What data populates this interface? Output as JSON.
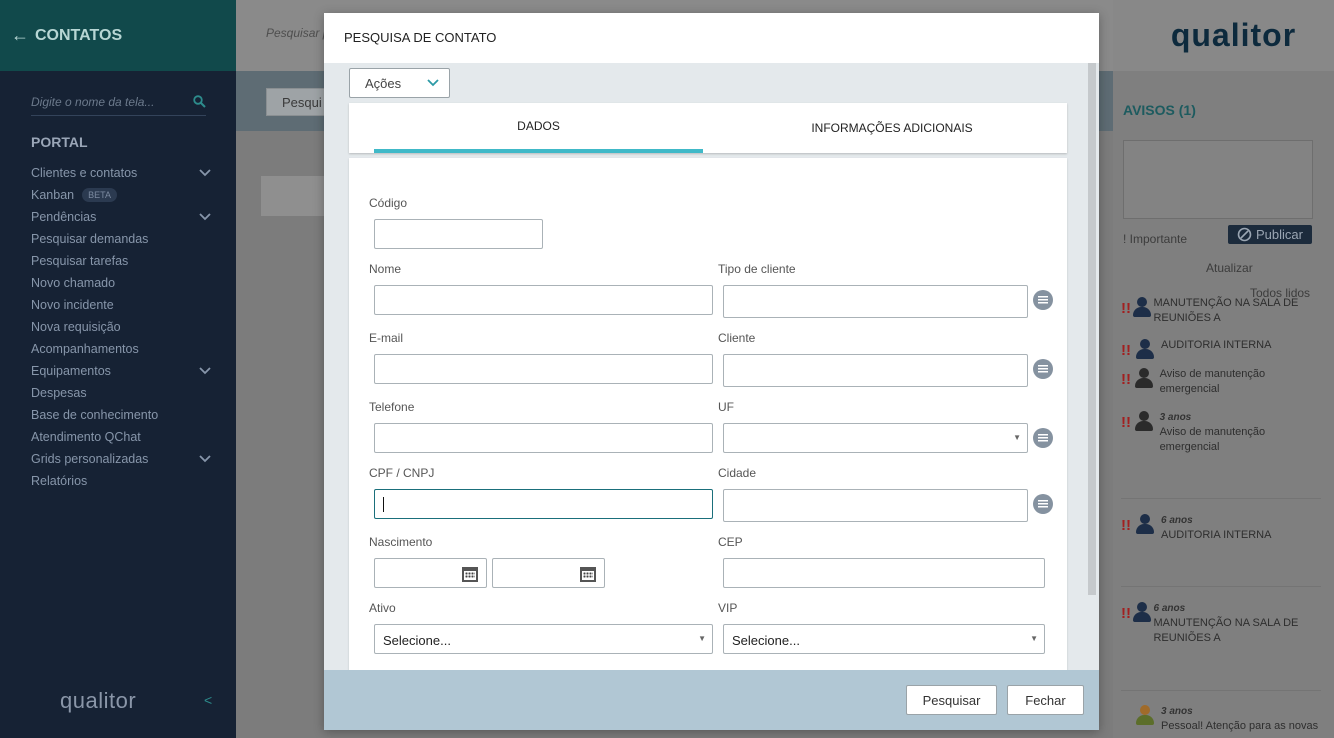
{
  "sidebar": {
    "title": "CONTATOS",
    "search_placeholder": "Digite o nome da tela...",
    "section": "PORTAL",
    "items": [
      {
        "label": "Clientes e contatos",
        "chevron": true
      },
      {
        "label": "Kanban",
        "badge": "BETA"
      },
      {
        "label": "Pendências",
        "chevron": true
      },
      {
        "label": "Pesquisar demandas"
      },
      {
        "label": "Pesquisar tarefas"
      },
      {
        "label": "Novo chamado"
      },
      {
        "label": "Novo incidente"
      },
      {
        "label": "Nova requisição"
      },
      {
        "label": "Acompanhamentos"
      },
      {
        "label": "Equipamentos",
        "chevron": true
      },
      {
        "label": "Despesas"
      },
      {
        "label": "Base de conhecimento"
      },
      {
        "label": "Atendimento QChat"
      },
      {
        "label": "Grids personalizadas",
        "chevron": true
      },
      {
        "label": "Relatórios"
      }
    ],
    "logo": "qualitor"
  },
  "main": {
    "search_placeholder": "Pesquisar p",
    "button_label": "Pesqui"
  },
  "right": {
    "logo": "qualitor",
    "avisos_title": "AVISOS (1)",
    "important_label": "! Importante",
    "publicar_label": "Publicar",
    "atualizar_label": "Atualizar",
    "todos_lidos_label": "Todos lidos",
    "notices": [
      {
        "when": "",
        "text": "MANUTENÇÃO NA SALA DE REUNIÕES A",
        "avatar": "p1"
      },
      {
        "when": "",
        "text": "AUDITORIA INTERNA",
        "avatar": "p1"
      },
      {
        "when": "",
        "text": "Aviso de manutenção emergencial",
        "avatar": "p2"
      },
      {
        "when": "3 anos",
        "text": "Aviso de manutenção emergencial",
        "avatar": "p2"
      },
      {
        "when": "6 anos",
        "text": "AUDITORIA INTERNA",
        "avatar": "p1"
      },
      {
        "when": "6 anos",
        "text": "MANUTENÇÃO NA SALA DE REUNIÕES A",
        "avatar": "p1"
      },
      {
        "when": "3 anos",
        "text": "Pessoal! Atenção para as novas",
        "avatar": "grp"
      }
    ]
  },
  "modal": {
    "title": "PESQUISA DE CONTATO",
    "acoes_label": "Ações",
    "tabs": [
      {
        "label": "DADOS",
        "active": true
      },
      {
        "label": "INFORMAÇÕES ADICIONAIS",
        "active": false
      }
    ],
    "fields": {
      "codigo": {
        "label": "Código",
        "value": ""
      },
      "nome": {
        "label": "Nome",
        "value": ""
      },
      "tipo_cliente": {
        "label": "Tipo de cliente",
        "value": ""
      },
      "email": {
        "label": "E-mail",
        "value": ""
      },
      "cliente": {
        "label": "Cliente",
        "value": ""
      },
      "telefone": {
        "label": "Telefone",
        "value": ""
      },
      "uf": {
        "label": "UF",
        "value": ""
      },
      "cpf_cnpj": {
        "label": "CPF / CNPJ",
        "value": ""
      },
      "cidade": {
        "label": "Cidade",
        "value": ""
      },
      "nascimento": {
        "label": "Nascimento",
        "from": "",
        "to": ""
      },
      "cep": {
        "label": "CEP",
        "value": ""
      },
      "ativo": {
        "label": "Ativo",
        "value": "Selecione..."
      },
      "vip": {
        "label": "VIP",
        "value": "Selecione..."
      }
    },
    "buttons": {
      "pesquisar": "Pesquisar",
      "fechar": "Fechar"
    }
  },
  "colors": {
    "accent": "#40b9c8",
    "sidebar_bg": "#162234",
    "alert": "#a21f1f",
    "footer_bg": "#b1c7d4"
  }
}
